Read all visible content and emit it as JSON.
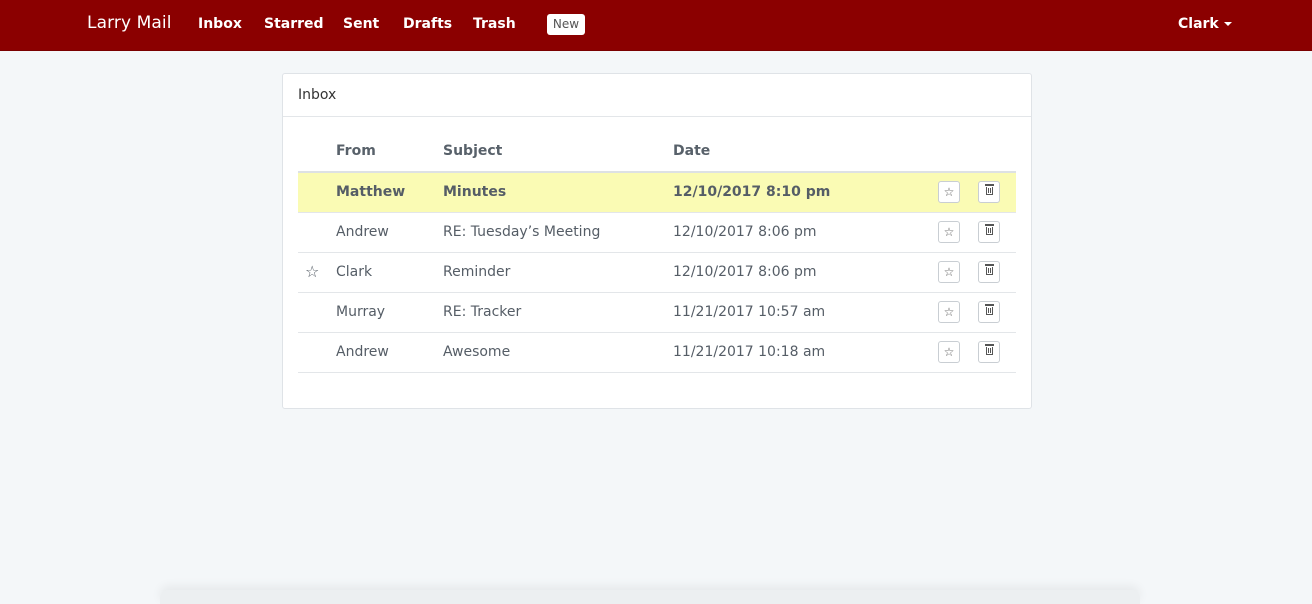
{
  "navbar": {
    "brand": "Larry Mail",
    "links": [
      "Inbox",
      "Starred",
      "Sent",
      "Drafts",
      "Trash"
    ],
    "new_label": "New",
    "user": "Clark",
    "color": "#8b0000"
  },
  "panel": {
    "title": "Inbox",
    "columns": {
      "from": "From",
      "subject": "Subject",
      "date": "Date"
    },
    "rows": [
      {
        "starred": false,
        "unread": true,
        "from": "Matthew",
        "subject": "Minutes",
        "date": "12/10/2017 8:10 pm"
      },
      {
        "starred": false,
        "unread": false,
        "from": "Andrew",
        "subject": "RE: Tuesday’s Meeting",
        "date": "12/10/2017 8:06 pm"
      },
      {
        "starred": true,
        "unread": false,
        "from": "Clark",
        "subject": "Reminder",
        "date": "12/10/2017 8:06 pm"
      },
      {
        "starred": false,
        "unread": false,
        "from": "Murray",
        "subject": "RE: Tracker",
        "date": "11/21/2017 10:57 am"
      },
      {
        "starred": false,
        "unread": false,
        "from": "Andrew",
        "subject": "Awesome",
        "date": "11/21/2017 10:18 am"
      }
    ],
    "star_icon": "☆",
    "unread_highlight": "#fafbb4"
  }
}
